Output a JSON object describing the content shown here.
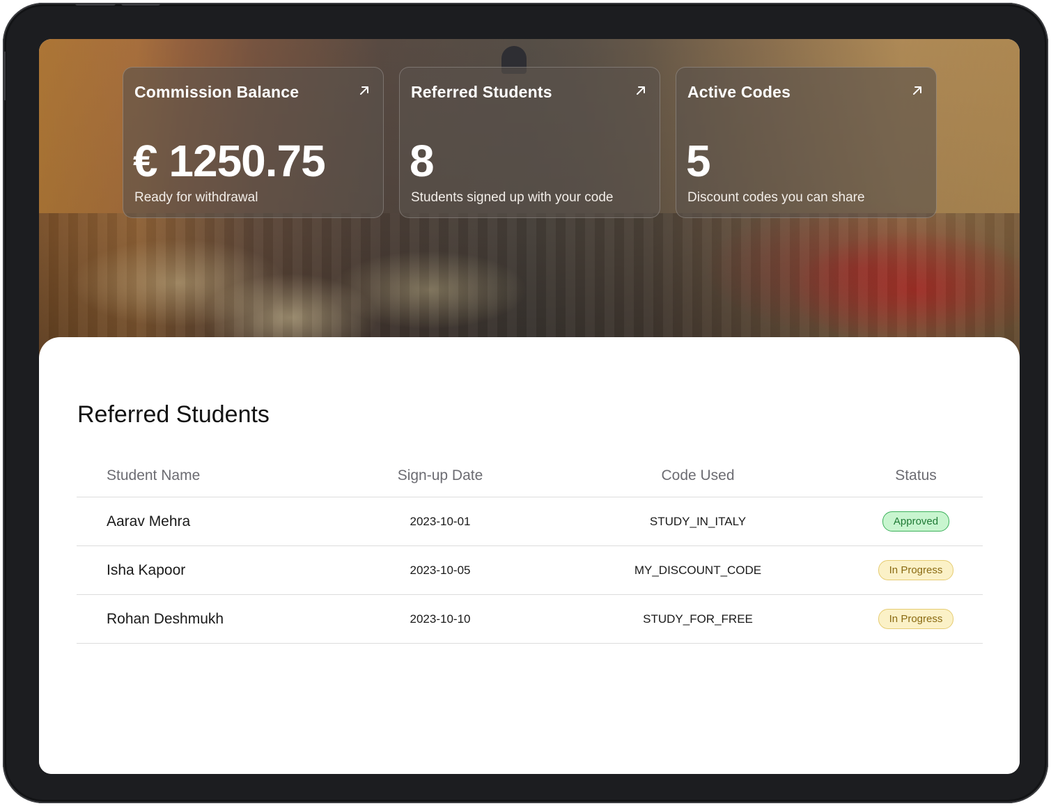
{
  "stats": [
    {
      "title": "Commission Balance",
      "value": "€ 1250.75",
      "subtitle": "Ready for withdrawal"
    },
    {
      "title": "Referred Students",
      "value": "8",
      "subtitle": "Students signed up with your code"
    },
    {
      "title": "Active Codes",
      "value": "5",
      "subtitle": "Discount codes you can share"
    }
  ],
  "section": {
    "title": "Referred Students"
  },
  "table": {
    "headers": [
      "Student Name",
      "Sign-up Date",
      "Code Used",
      "Status"
    ],
    "rows": [
      {
        "name": "Aarav Mehra",
        "date": "2023-10-01",
        "code": "STUDY_IN_ITALY",
        "status": "Approved",
        "status_kind": "approved"
      },
      {
        "name": "Isha Kapoor",
        "date": "2023-10-05",
        "code": "MY_DISCOUNT_CODE",
        "status": "In Progress",
        "status_kind": "progress"
      },
      {
        "name": "Rohan Deshmukh",
        "date": "2023-10-10",
        "code": "STUDY_FOR_FREE",
        "status": "In Progress",
        "status_kind": "progress"
      }
    ]
  },
  "colors": {
    "approved_bg": "#c8f5cf",
    "approved_text": "#1f7a35",
    "progress_bg": "#fbf1c7",
    "progress_text": "#8a6a12"
  },
  "icons": {
    "card_link": "arrow-up-right-icon"
  }
}
